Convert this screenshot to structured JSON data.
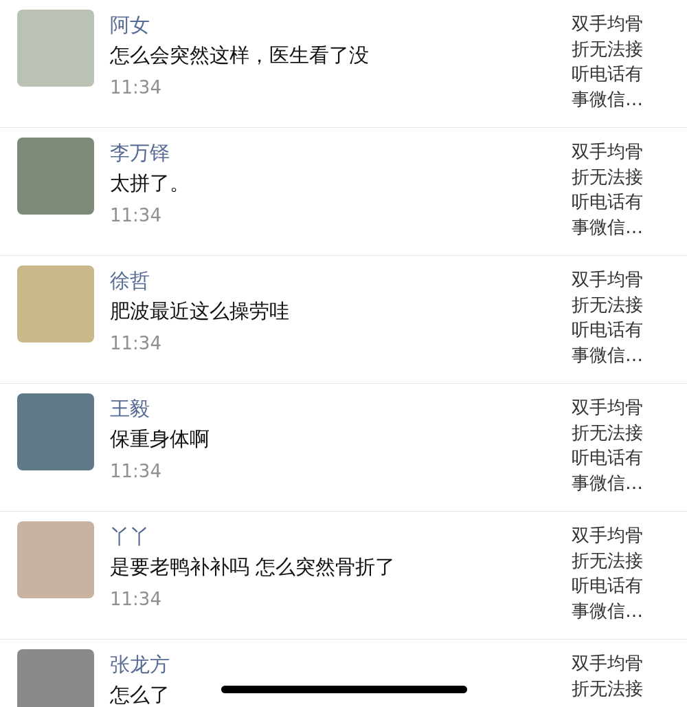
{
  "notifications": [
    {
      "name": "阿女",
      "comment": "怎么会突然这样，医生看了没",
      "time": "11:34",
      "post_excerpt": "双手均骨折无法接听电话有事微信…"
    },
    {
      "name": "李万铎",
      "comment": "太拼了。",
      "time": "11:34",
      "post_excerpt": "双手均骨折无法接听电话有事微信…"
    },
    {
      "name": "徐哲",
      "comment": "肥波最近这么操劳哇",
      "time": "11:34",
      "post_excerpt": "双手均骨折无法接听电话有事微信…"
    },
    {
      "name": "王毅",
      "comment": "保重身体啊",
      "time": "11:34",
      "post_excerpt": "双手均骨折无法接听电话有事微信…"
    },
    {
      "name": "丫丫",
      "comment": "是要老鸭补补吗 怎么突然骨折了",
      "time": "11:34",
      "post_excerpt": "双手均骨折无法接听电话有事微信…"
    },
    {
      "name": "张龙方",
      "comment": "怎么了",
      "post_excerpt": "双手均骨折无法接"
    }
  ]
}
